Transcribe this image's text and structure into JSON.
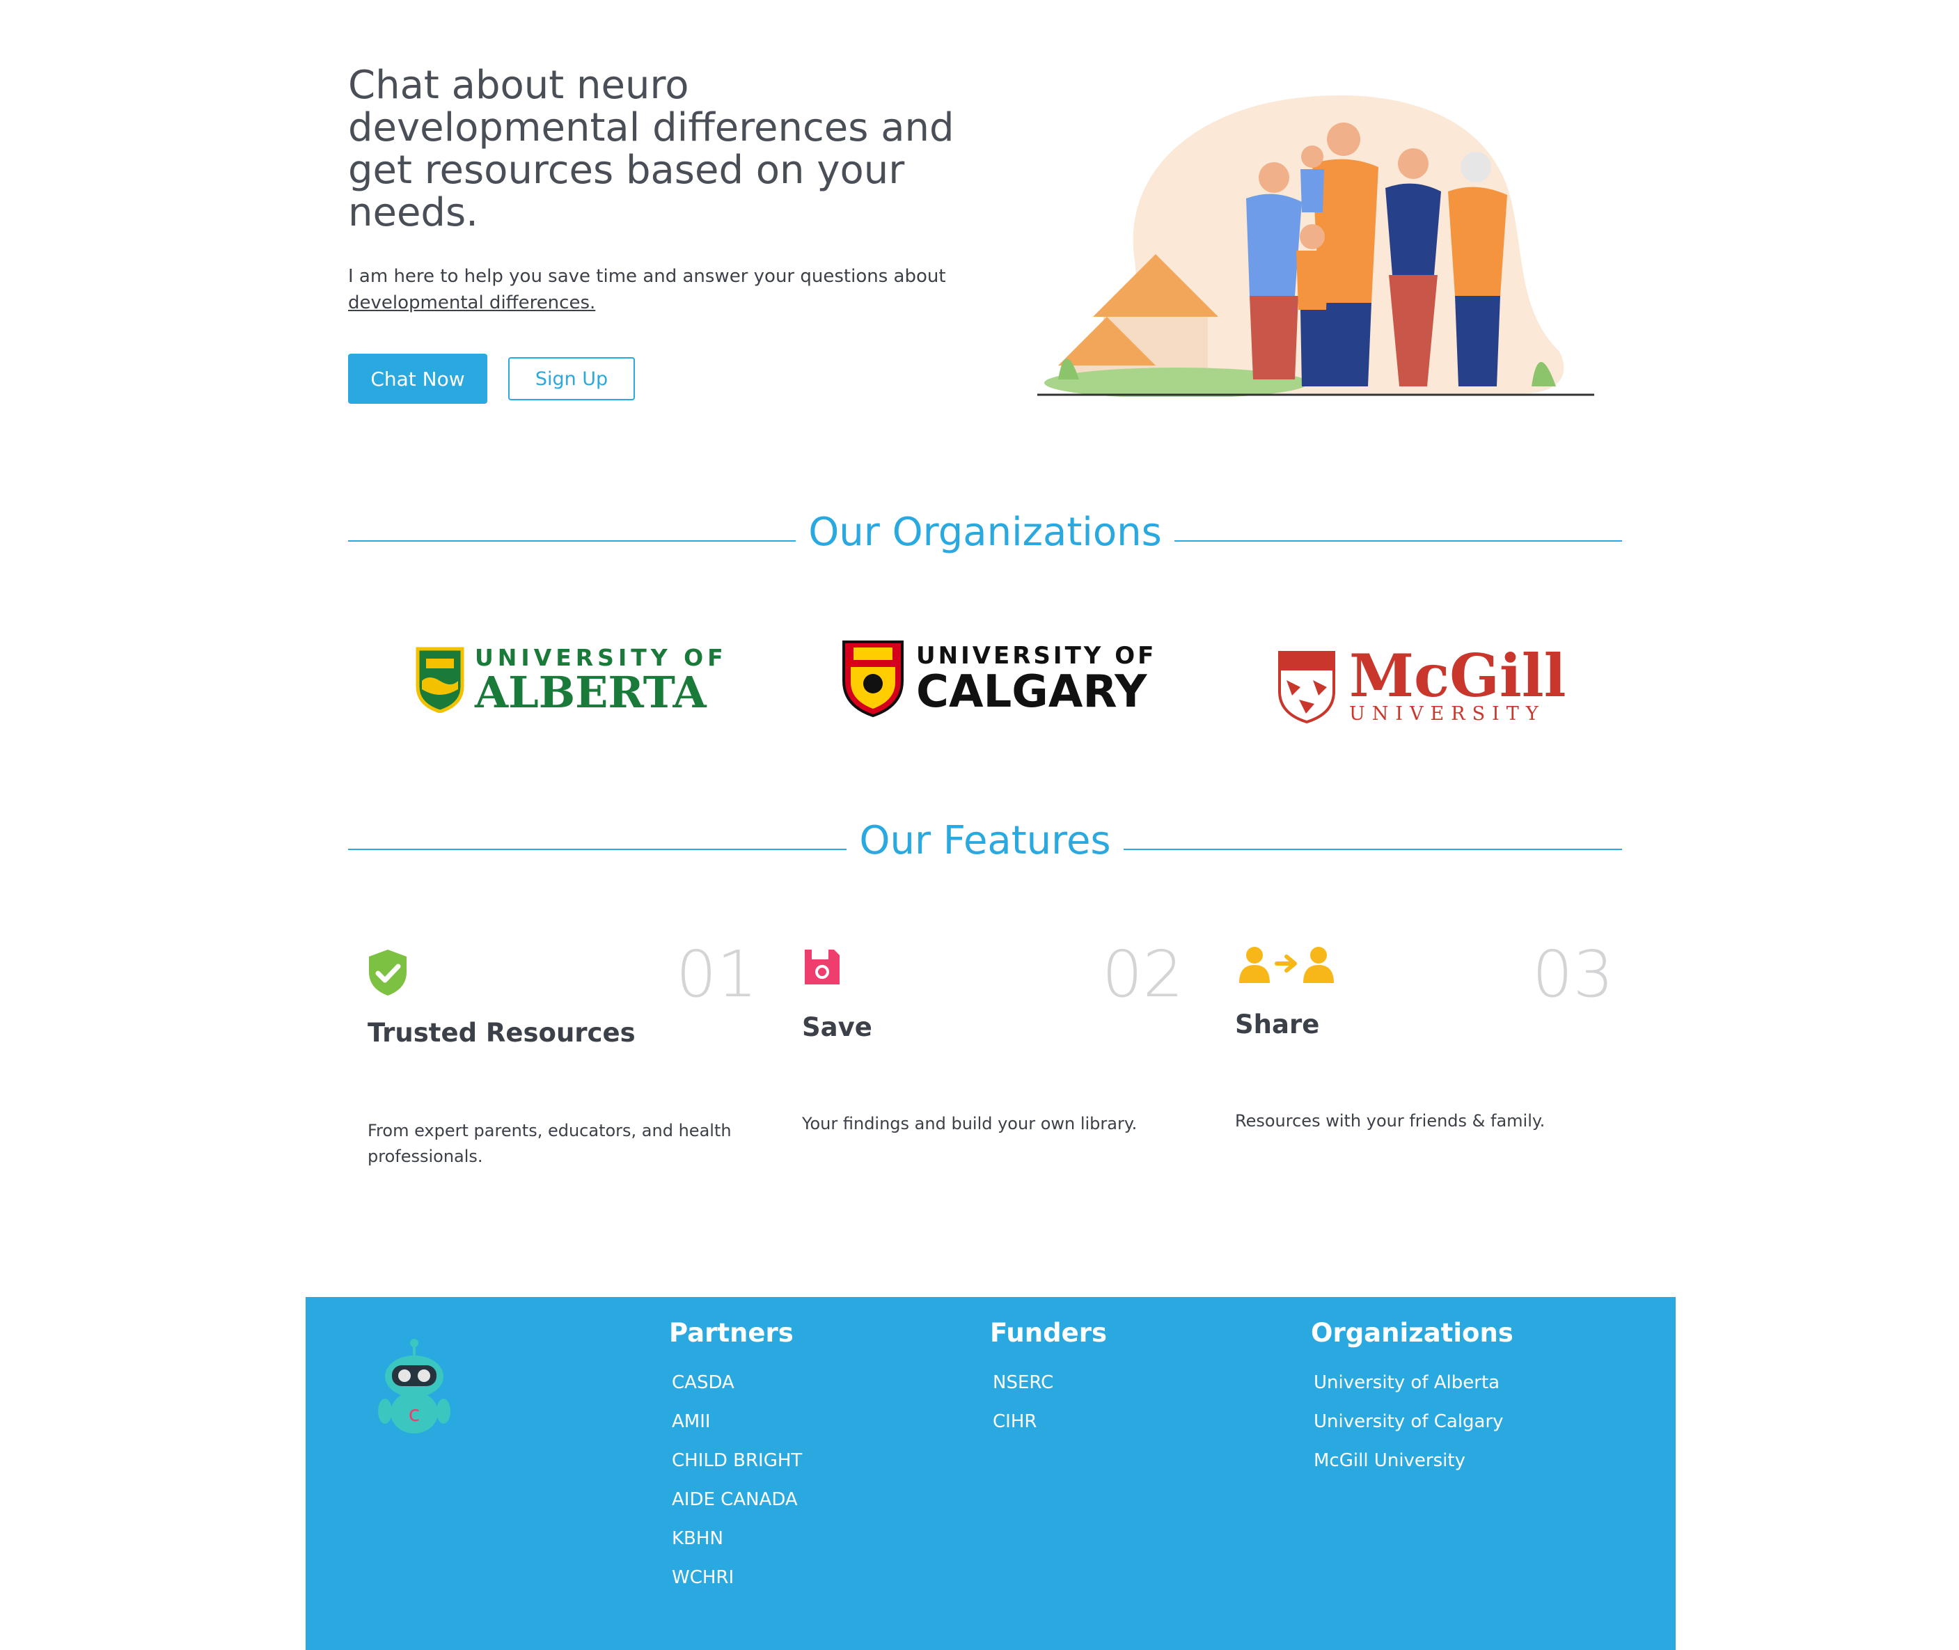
{
  "hero": {
    "title": "Chat about neuro developmental differences and get resources based on your needs.",
    "subtitle_text": "I am here to help you save time and answer your questions about",
    "subtitle_link": "developmental differences.",
    "chat_button": "Chat Now",
    "signup_button": "Sign Up"
  },
  "organizations": {
    "title": "Our Organizations",
    "logos": [
      {
        "line1": "UNIVERSITY OF",
        "line2": "ALBERTA",
        "color": "#1a7a3a"
      },
      {
        "line1": "UNIVERSITY OF",
        "line2": "CALGARY",
        "color": "#111111"
      },
      {
        "line1": "McGill",
        "line2": "UNIVERSITY",
        "color": "#c9372c"
      }
    ]
  },
  "features": {
    "title": "Our Features",
    "items": [
      {
        "number": "01",
        "title": "Trusted Resources",
        "description": "From expert parents, educators, and health professionals.",
        "icon": "shield-check-icon",
        "icon_color": "#7cc142"
      },
      {
        "number": "02",
        "title": "Save",
        "description": "Your findings and build your own library.",
        "icon": "floppy-disk-icon",
        "icon_color": "#ef3d6e"
      },
      {
        "number": "03",
        "title": "Share",
        "description": "Resources with your friends & family.",
        "icon": "share-users-icon",
        "icon_color": "#f7b718"
      }
    ]
  },
  "footer": {
    "background": "#29a9e0",
    "partners": {
      "title": "Partners",
      "items": [
        "CASDA",
        "AMII",
        "CHILD BRIGHT",
        "AIDE CANADA",
        "KBHN",
        "WCHRI"
      ]
    },
    "funders": {
      "title": "Funders",
      "items": [
        "NSERC",
        "CIHR"
      ]
    },
    "organizations": {
      "title": "Organizations",
      "items": [
        "University of Alberta",
        "University of Calgary",
        "McGill University"
      ]
    }
  },
  "colors": {
    "accent": "#29a9e0",
    "text": "#4a4f57"
  }
}
